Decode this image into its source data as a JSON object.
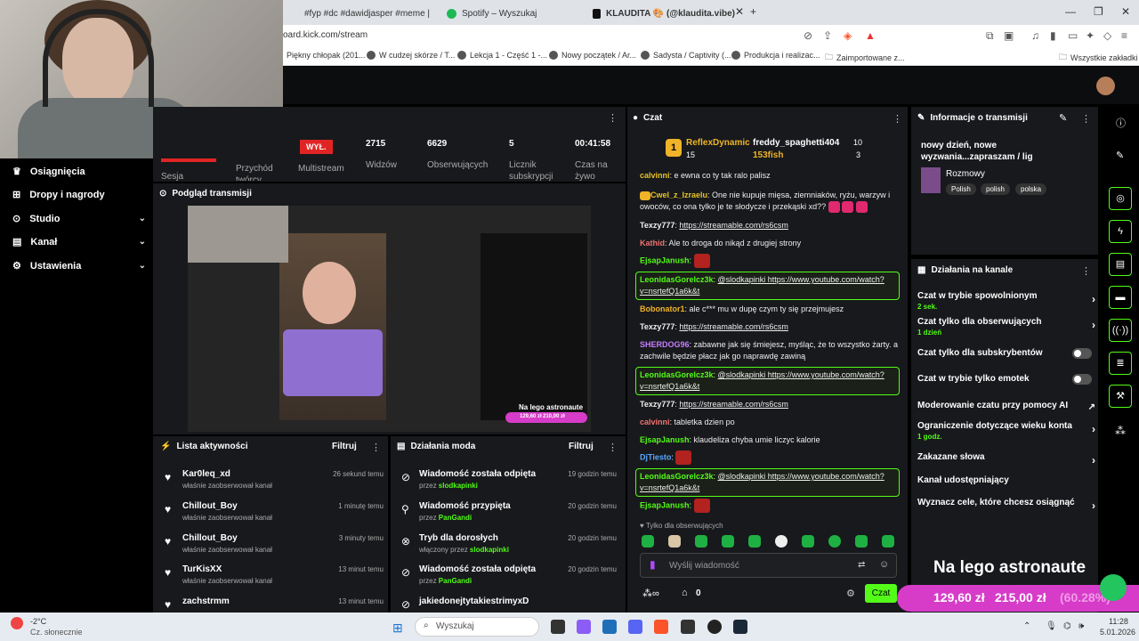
{
  "browser": {
    "tabs": [
      {
        "label": "#fyp #dc #dawidjasper #meme | TikT"
      },
      {
        "label": "Spotify – Wyszukaj"
      },
      {
        "label": "KLAUDITA 🎨 (@klaudita.vibe)"
      }
    ],
    "url": "oard.kick.com/stream",
    "bookmarks": [
      "Piękny chłopak (201...",
      "W cudzej skórze / T...",
      "Lekcja 1 - Część 1 -...",
      "Nowy początek / Ar...",
      "Sadysta / Captivity (...",
      "Produkcja i realizac...",
      "Zaimportowane z..."
    ],
    "all_bookmarks": "Wszystkie zakładki"
  },
  "nav": {
    "items": [
      {
        "label": "Osiągnięcia",
        "icon": "trophy-icon"
      },
      {
        "label": "Dropy i nagrody",
        "icon": "gift-icon"
      },
      {
        "label": "Studio",
        "icon": "studio-icon"
      },
      {
        "label": "Kanał",
        "icon": "channel-icon"
      },
      {
        "label": "Ustawienia",
        "icon": "gear-icon"
      }
    ]
  },
  "stats": {
    "session_label": "Sesja",
    "income_label": "Przychód twórcy",
    "multistream_label": "Multistream",
    "multistream_button": "WYŁ.",
    "viewers": {
      "value": "2715",
      "label": "Widzów"
    },
    "followers": {
      "value": "6629",
      "label": "Obserwujących"
    },
    "subs": {
      "value": "5",
      "label": "Licznik subskrypcji"
    },
    "time": {
      "value": "00:41:58",
      "label": "Czas na żywo"
    }
  },
  "preview": {
    "title": "Podgląd transmisji",
    "overlay_text": "Na lego astronaute",
    "price1": "129,60 zł",
    "price2": "210,00 zł"
  },
  "activity": {
    "title": "Lista aktywności",
    "filter": "Filtruj",
    "items": [
      {
        "name": "Kar0leq_xd",
        "action": "właśnie zaobserwował kanał",
        "time": "26 sekund temu"
      },
      {
        "name": "Chillout_Boy",
        "action": "właśnie zaobserwował kanał",
        "time": "1 minutę temu"
      },
      {
        "name": "Chillout_Boy",
        "action": "właśnie zaobserwował kanał",
        "time": "3 minuty temu"
      },
      {
        "name": "TurKisXX",
        "action": "właśnie zaobserwował kanał",
        "time": "13 minut temu"
      },
      {
        "name": "zachstrmm",
        "action": "",
        "time": "13 minut temu"
      }
    ]
  },
  "modactions": {
    "title": "Działania moda",
    "filter": "Filtruj",
    "items": [
      {
        "name": "Wiadomość została odpięta",
        "prefix": "przez",
        "user": "slodkapinki",
        "time": "19 godzin temu",
        "icon": "unpin-icon"
      },
      {
        "name": "Wiadomość przypięta",
        "prefix": "przez",
        "user": "PanGandi",
        "time": "20 godzin temu",
        "icon": "pin-icon"
      },
      {
        "name": "Tryb dla dorosłych",
        "prefix": "włączony przez",
        "user": "slodkapinki",
        "time": "20 godzin temu",
        "icon": "eye-off-icon"
      },
      {
        "name": "Wiadomość została odpięta",
        "prefix": "przez",
        "user": "PanGandi",
        "time": "20 godzin temu",
        "icon": "unpin-icon"
      },
      {
        "name": "jakiedonejtytakiestrimyxD",
        "prefix": "",
        "user": "",
        "time": "",
        "icon": "unpin-icon"
      }
    ]
  },
  "chat": {
    "title": "Czat",
    "top": [
      {
        "name": "ReflexDynamic",
        "count": "15"
      },
      {
        "name": "freddy_spaghetti404",
        "count": "10"
      },
      {
        "name": "153fish",
        "count": "3"
      }
    ],
    "messages": [
      {
        "user": "calvinni",
        "text": "e ewna co ty tak ralo palisz"
      },
      {
        "user": "Cwel_z_Izraelu",
        "text": "One nie kupuje mięsa, ziemniaków, ryżu, warzyw i owoców, co ona tylko je te słodycze i przekąski xd??"
      },
      {
        "user": "Texzy777",
        "text": "https://streamable.com/rs6csm"
      },
      {
        "user": "Kathid",
        "text": "Ale to droga do nikąd z drugiej strony"
      },
      {
        "user": "EjsapJanush",
        "text": ""
      },
      {
        "user": "LeonidasGorelcz3k",
        "text": "@slodkapinki https://www.youtube.com/watch?v=nsrtefQ1a6k&t"
      },
      {
        "user": "Bobonator1",
        "text": "ale c*** mu w dupę czym ty się przejmujesz"
      },
      {
        "user": "Texzy777",
        "text": "https://streamable.com/rs6csm"
      },
      {
        "user": "SHERDOG96",
        "text": "zabawne jak się śmiejesz, myśląc, że to wszystko żarty. a zachwile będzie płacz jak go naprawdę zawiną"
      },
      {
        "user": "LeonidasGorelcz3k",
        "text": "@slodkapinki https://www.youtube.com/watch?v=nsrtefQ1a6k&t"
      },
      {
        "user": "Texzy777",
        "text": "https://streamable.com/rs6csm"
      },
      {
        "user": "calvinni",
        "text": "tabletka dzien po"
      },
      {
        "user": "EjsapJanush",
        "text": "klaudeliza chyba umie liczyc kalorie"
      },
      {
        "user": "DjTiesto",
        "text": ""
      },
      {
        "user": "LeonidasGorelcz3k",
        "text": "@slodkapinki https://www.youtube.com/watch?v=nsrtefQ1a6k&t"
      },
      {
        "user": "EjsapJanush",
        "text": ""
      }
    ],
    "followers_only": "Tylko dla obserwujących",
    "input_placeholder": "Wyślij wiadomość",
    "points": "0",
    "send": "Czat"
  },
  "info": {
    "title": "Informacje o transmisji",
    "stream_title": "nowy dzień, nowe wyzwania...zapraszam / lig",
    "category": "Rozmowy",
    "tags": [
      "Polish",
      "polish",
      "polska"
    ]
  },
  "channel_actions": {
    "title": "Działania na kanale",
    "options": [
      {
        "label": "Czat w trybie spowolnionym",
        "sub": "2 sek.",
        "control": "arrow"
      },
      {
        "label": "Czat tylko dla obserwujących",
        "sub": "1 dzień",
        "control": "arrow"
      },
      {
        "label": "Czat tylko dla subskrybentów",
        "sub": "",
        "control": "toggle"
      },
      {
        "label": "Czat w trybie tylko emotek",
        "sub": "",
        "control": "toggle"
      },
      {
        "label": "Moderowanie czatu przy pomocy AI",
        "sub": "",
        "control": "external"
      },
      {
        "label": "Ograniczenie dotyczące wieku konta",
        "sub": "1 godz.",
        "control": "arrow"
      },
      {
        "label": "Zakazane słowa",
        "sub": "",
        "control": "arrow"
      },
      {
        "label": "Kanał udostępniający",
        "sub": "",
        "control": "none"
      },
      {
        "label": "Wyznacz cele, które chcesz osiągnąć",
        "sub": "",
        "control": "arrow"
      }
    ]
  },
  "overlay": {
    "text": "Na lego astronaute",
    "price1": "129,60 zł",
    "price2": "215,00 zł",
    "percent": "(60.28%)"
  },
  "taskbar": {
    "weather_temp": "-2°C",
    "weather_desc": "Cz. słonecznie",
    "search": "Wyszukaj",
    "time": "11:28",
    "date": "5.01.2026"
  },
  "colors": {
    "accent": "#53fc18",
    "bg": "#000000",
    "panel": "#17191c",
    "alert": "#e02424",
    "overlay_pink": "#d63cc8"
  }
}
